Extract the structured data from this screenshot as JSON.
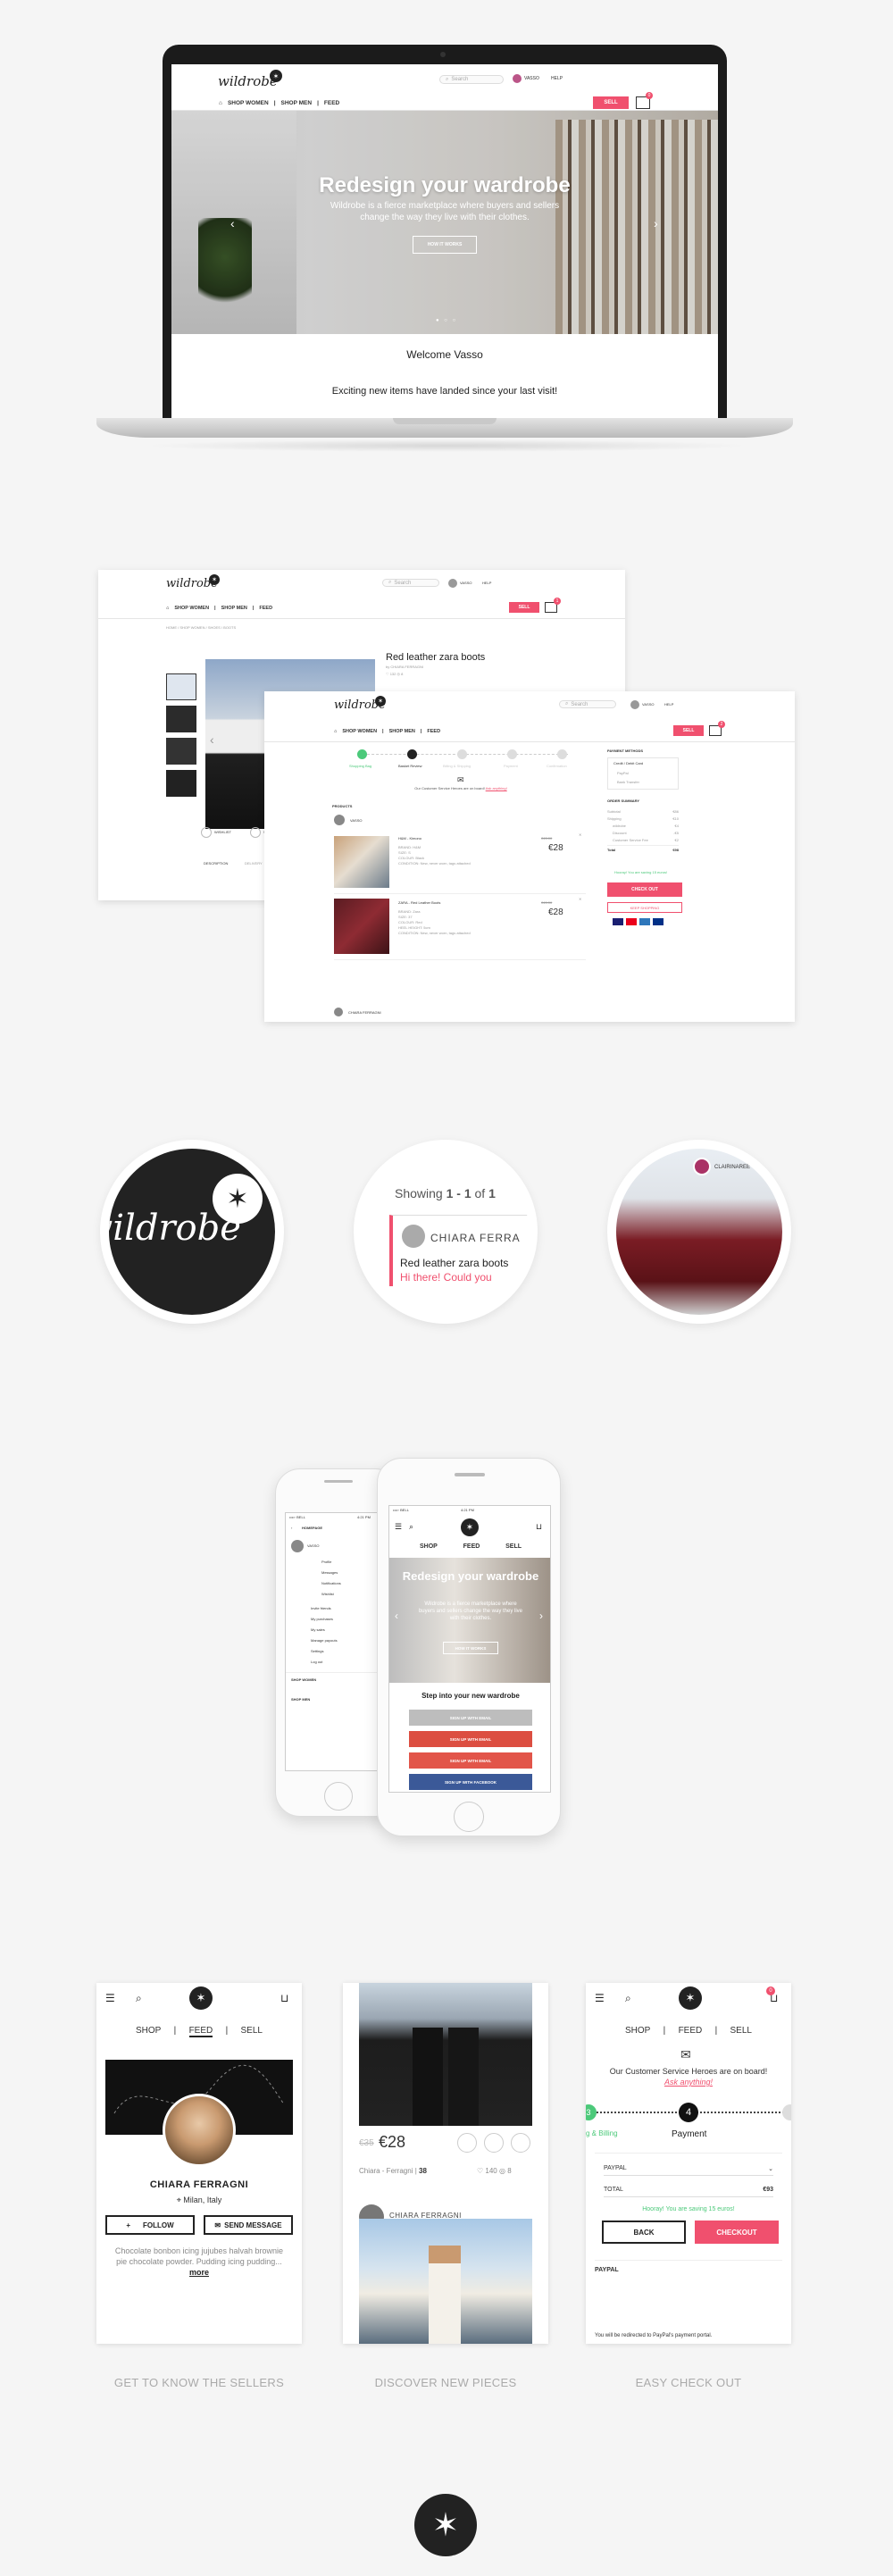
{
  "laptop": {
    "logo": "wildrobe",
    "search_placeholder": "Search",
    "user": "VASSO",
    "help": "HELP",
    "nav": [
      "SHOP WOMEN",
      "SHOP MEN",
      "FEED"
    ],
    "sell": "SELL",
    "cart_count": "0",
    "hero_title": "Redesign your wardrobe",
    "hero_subtitle": "Wildrobe is a fierce marketplace where buyers and sellers change the way they live with their clothes.",
    "hero_button": "HOW IT WORKS",
    "welcome": "Welcome Vasso",
    "welcome_sub": "Exciting new items have landed since your last visit!"
  },
  "product_page": {
    "logo": "wildrobe",
    "search_placeholder": "Search",
    "user": "VASSO",
    "help": "HELP",
    "nav": [
      "SHOP WOMEN",
      "SHOP MEN",
      "FEED"
    ],
    "sell": "SELL",
    "cart_count": "1",
    "breadcrumb": "HOME / SHOP WOMEN / SHOES / BOOTS",
    "title": "Red leather zara boots",
    "seller": "by CHIARA FERRAGNI",
    "stats": "♡ 132   ◎ 8",
    "wishlist": "WISHLIST",
    "share": "SHARE",
    "description_tab": "DESCRIPTION",
    "delivery_tab": "DELIVERY"
  },
  "checkout_page": {
    "logo": "wildrobe",
    "search_placeholder": "Search",
    "user": "VASSO",
    "help": "HELP",
    "nav": [
      "SHOP WOMEN",
      "SHOP MEN",
      "FEED"
    ],
    "sell": "SELL",
    "cart_count": "2",
    "steps": [
      "Shopping Bag",
      "Basket Review",
      "Billing & Shipping",
      "Payment",
      "Confirmation"
    ],
    "service_note": "Our Customer Service Heroes are on board!",
    "service_link": "Ask anything!",
    "products_label": "PRODUCTS",
    "seller_1": "VASSO",
    "items": [
      {
        "name": "H&M - Kimono",
        "old_price": "€45.00",
        "price": "€28",
        "brand": "BRAND: H&M",
        "size": "SIZE: S",
        "colour": "COLOUR: Black",
        "condition": "CONDITION: New, never worn, tags attached"
      },
      {
        "name": "ZARA - Red Leather Boots",
        "old_price": "€45.00",
        "price": "€28",
        "brand": "BRAND: Zara",
        "size": "SIZE: 37",
        "colour": "COLOUR: Red",
        "heel": "HEEL HEIGHT: 5cm",
        "condition": "CONDITION: New, never worn, tags attached"
      }
    ],
    "seller_2": "CHIARA FERRAGNI",
    "payment_methods": "PAYMENT METHODS",
    "pay_options": [
      "Credit / Debit Card",
      "PayPal",
      "Bank Transfer"
    ],
    "order_summary": "ORDER SUMMARY",
    "summary_rows": [
      {
        "label": "Subtotal",
        "value": "€86"
      },
      {
        "label": "Shipping",
        "value": "€10"
      },
      {
        "label": "wildrobe",
        "value": "€4"
      },
      {
        "label": "Discount",
        "value": "-€5"
      },
      {
        "label": "Customer Service Fee",
        "value": "€2"
      }
    ],
    "total_label": "Total",
    "total_value": "€98",
    "saving": "Hooray! You are saving 15 euros!",
    "checkout": "CHECK OUT",
    "continue": "KEEP SHOPPING"
  },
  "circles": {
    "logo_text": "wildrobe",
    "showing_prefix": "Showing",
    "showing_range": "1 - 1",
    "showing_of": "of",
    "showing_total": "1",
    "seller": "CHIARA FERRA",
    "item": "Red leather zara boots",
    "message": "Hi there! Could you",
    "circle3_user": "CLAIRINAREE"
  },
  "phones": {
    "back_status": "••••◦ BELL",
    "back_time": "4:21 PM",
    "back_title": "HOMEPAGE",
    "back_user": "VASSO",
    "menu": [
      "Profile",
      "Messages",
      "Notifications",
      "Wishlist"
    ],
    "menu2": [
      "Invite friends",
      "My purchases",
      "My sales",
      "Manage payouts",
      "Settings",
      "Log out"
    ],
    "shop_women": "SHOP WOMEN",
    "shop_men": "SHOP MEN",
    "front_status": "••••◦ BELL",
    "front_time": "4:21 PM",
    "tabs": [
      "SHOP",
      "FEED",
      "SELL"
    ],
    "hero_title": "Redesign your wardrobe",
    "hero_sub": "Wildrobe is a fierce marketplace where buyers and sellers change the way they live with their clothes.",
    "hero_btn": "HOW IT WORKS",
    "step_title": "Step into your new wardrobe",
    "signin_email": "SIGN UP WITH EMAIL",
    "signin_google": "SIGN UP WITH EMAIL",
    "signin_facebook": "SIGN UP WITH FACEBOOK",
    "signin_top": "SIGN UP WITH EMAIL"
  },
  "mobile_cards": {
    "tabs": [
      "SHOP",
      "FEED",
      "SELL"
    ],
    "profile_name": "CHIARA FERRAGNI",
    "location": "Milan, Italy",
    "follow": "FOLLOW",
    "send_message": "SEND MESSAGE",
    "bio": "Chocolate bonbon icing jujubes halvah brownie pie chocolate powder. Pudding icing pudding...",
    "more": "more",
    "old_price": "€35",
    "price": "€28",
    "feed_seller": "Chiara - Ferragni",
    "feed_size": "38",
    "feed_likes": "140",
    "feed_comments": "8",
    "feed_seller_2": "CHIARA FERRAGNI",
    "cart_count": "0",
    "service_note": "Our Customer Service Heroes are on board!",
    "service_link": "Ask anything!",
    "step_left": "g & Billing",
    "step_number": "4",
    "step_label": "Payment",
    "step_done": "3",
    "paypal": "PAYPAL",
    "total_label": "TOTAL",
    "total_value": "€93",
    "saving": "Hooray! You are saving 15 euros!",
    "back": "BACK",
    "checkout": "CHECKOUT",
    "paypal_section": "PAYPAL",
    "redirect": "You will be redirected to PayPal's payment portal."
  },
  "captions": [
    "GET TO KNOW THE SELLERS",
    "DISCOVER NEW PIECES",
    "EASY CHECK OUT"
  ],
  "colors": {
    "accent": "#f0506e",
    "dark": "#222222",
    "background": "#f5f5f5"
  }
}
